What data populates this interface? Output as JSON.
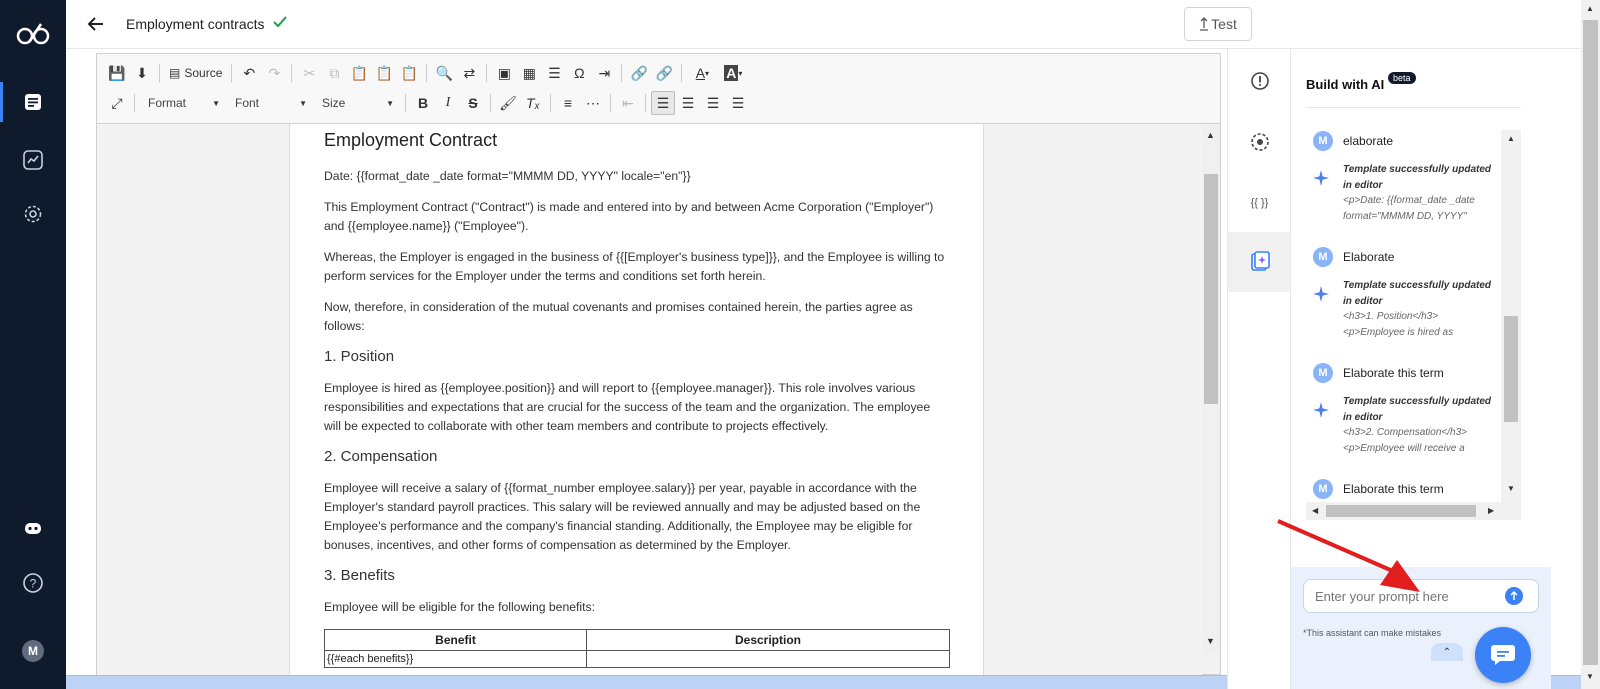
{
  "rail": {
    "avatar": "M"
  },
  "header": {
    "title": "Employment contracts",
    "test_label": "Test"
  },
  "toolbar": {
    "source_label": "Source",
    "format_label": "Format",
    "font_label": "Font",
    "size_label": "Size"
  },
  "document": {
    "title": "Employment Contract",
    "date_line": "Date: {{format_date _date format=\"MMMM DD, YYYY\" locale=\"en\"}}",
    "intro": "This Employment Contract (\"Contract\") is made and entered into by and between Acme Corporation (\"Employer\") and {{employee.name}} (\"Employee\").",
    "whereas": "Whereas, the Employer is engaged in the business of {{[Employer's business type]}}, and the Employee is willing to perform services for the Employer under the terms and conditions set forth herein.",
    "now_therefore": "Now, therefore, in consideration of the mutual covenants and promises contained herein, the parties agree as follows:",
    "s1_title": "1. Position",
    "s1_body": "Employee is hired as {{employee.position}} and will report to {{employee.manager}}. This role involves various responsibilities and expectations that are crucial for the success of the team and the organization. The employee will be expected to collaborate with other team members and contribute to projects effectively.",
    "s2_title": "2. Compensation",
    "s2_body": "Employee will receive a salary of {{format_number employee.salary}} per year, payable in accordance with the Employer's standard payroll practices. This salary will be reviewed annually and may be adjusted based on the Employee's performance and the company's financial standing. Additionally, the Employee may be eligible for bonuses, incentives, and other forms of compensation as determined by the Employer.",
    "s3_title": "3. Benefits",
    "s3_body": "Employee will be eligible for the following benefits:",
    "table_headers": [
      "Benefit",
      "Description"
    ],
    "table_first_cell": "{{#each benefits}}"
  },
  "icon_column": {
    "variables_label": "{{ }}"
  },
  "ai_panel": {
    "title": "Build with AI",
    "badge": "beta",
    "messages": [
      {
        "user": "elaborate",
        "status": "Template successfully updated in editor",
        "code1": "<p>Date: {{format_date _date",
        "code2": "format=\"MMMM DD, YYYY\""
      },
      {
        "user": "Elaborate",
        "status": "Template successfully updated in editor",
        "code1": "<h3>1. Position</h3>",
        "code2": "<p>Employee is hired as"
      },
      {
        "user": "Elaborate this term",
        "status": "Template successfully updated in editor",
        "code1": "<h3>2. Compensation</h3>",
        "code2": "<p>Employee will receive a"
      },
      {
        "user": "Elaborate this term"
      }
    ],
    "user_avatar": "M",
    "prompt_placeholder": "Enter your prompt here",
    "disclaimer": "*This assistant can make mistakes"
  },
  "colors": {
    "rail_bg": "#0f1b2d",
    "accent": "#3b82f6",
    "success": "#16a34a",
    "annotation": "#e11d1d"
  }
}
